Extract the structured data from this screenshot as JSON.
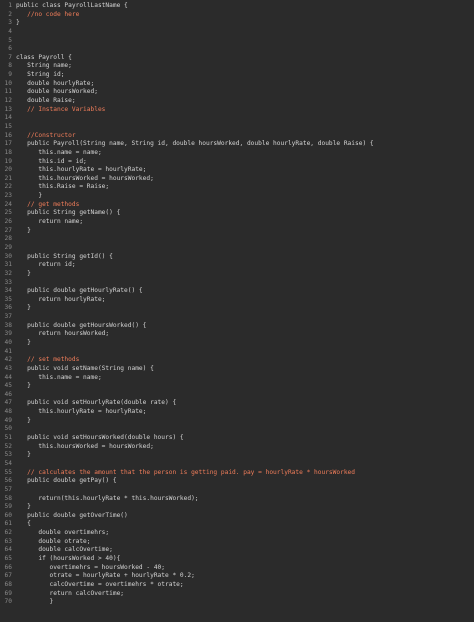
{
  "editor": {
    "colors": {
      "background": "#2b2b2b",
      "text": "#d4d4d4",
      "line_number": "#8a8a8a",
      "comment": "#f07d5a"
    },
    "lines": [
      {
        "n": "1",
        "text": "public class PayrollLastName {"
      },
      {
        "n": "2",
        "text": "   //no code here"
      },
      {
        "n": "3",
        "text": "}"
      },
      {
        "n": "4",
        "text": ""
      },
      {
        "n": "5",
        "text": ""
      },
      {
        "n": "6",
        "text": ""
      },
      {
        "n": "7",
        "text": "class Payroll {"
      },
      {
        "n": "8",
        "text": "   String name;"
      },
      {
        "n": "9",
        "text": "   String id;"
      },
      {
        "n": "10",
        "text": "   double hourlyRate;"
      },
      {
        "n": "11",
        "text": "   double hoursWorked;"
      },
      {
        "n": "12",
        "text": "   double Raise;"
      },
      {
        "n": "13",
        "text": "   // Instance Variables"
      },
      {
        "n": "14",
        "text": ""
      },
      {
        "n": "15",
        "text": ""
      },
      {
        "n": "16",
        "text": "   //Constructor"
      },
      {
        "n": "17",
        "text": "   public Payroll(String name, String id, double hoursWorked, double hourlyRate, double Raise) {"
      },
      {
        "n": "18",
        "text": "      this.name = name;"
      },
      {
        "n": "19",
        "text": "      this.id = id;"
      },
      {
        "n": "20",
        "text": "      this.hourlyRate = hourlyRate;"
      },
      {
        "n": "21",
        "text": "      this.hoursWorked = hoursWorked;"
      },
      {
        "n": "22",
        "text": "      this.Raise = Raise;"
      },
      {
        "n": "23",
        "text": "      }"
      },
      {
        "n": "24",
        "text": "   // get methods"
      },
      {
        "n": "25",
        "text": "   public String getName() {"
      },
      {
        "n": "26",
        "text": "      return name;"
      },
      {
        "n": "27",
        "text": "   }"
      },
      {
        "n": "28",
        "text": ""
      },
      {
        "n": "29",
        "text": ""
      },
      {
        "n": "30",
        "text": "   public String getId() {"
      },
      {
        "n": "31",
        "text": "      return id;"
      },
      {
        "n": "32",
        "text": "   }"
      },
      {
        "n": "33",
        "text": ""
      },
      {
        "n": "34",
        "text": "   public double getHourlyRate() {"
      },
      {
        "n": "35",
        "text": "      return hourlyRate;"
      },
      {
        "n": "36",
        "text": "   }"
      },
      {
        "n": "37",
        "text": ""
      },
      {
        "n": "38",
        "text": "   public double getHoursWorked() {"
      },
      {
        "n": "39",
        "text": "      return hoursWorked;"
      },
      {
        "n": "40",
        "text": "   }"
      },
      {
        "n": "41",
        "text": ""
      },
      {
        "n": "42",
        "text": "   // set methods"
      },
      {
        "n": "43",
        "text": "   public void setName(String name) {"
      },
      {
        "n": "44",
        "text": "      this.name = name;"
      },
      {
        "n": "45",
        "text": "   }"
      },
      {
        "n": "46",
        "text": ""
      },
      {
        "n": "47",
        "text": "   public void setHourlyRate(double rate) {"
      },
      {
        "n": "48",
        "text": "      this.hourlyRate = hourlyRate;"
      },
      {
        "n": "49",
        "text": "   }"
      },
      {
        "n": "50",
        "text": ""
      },
      {
        "n": "51",
        "text": "   public void setHoursWorked(double hours) {"
      },
      {
        "n": "52",
        "text": "      this.hoursWorked = hoursWorked;"
      },
      {
        "n": "53",
        "text": "   }"
      },
      {
        "n": "54",
        "text": ""
      },
      {
        "n": "55",
        "text": "   // calculates the amount that the person is getting paid. pay = hourlyRate * hoursWorked"
      },
      {
        "n": "56",
        "text": "   public double getPay() {"
      },
      {
        "n": "57",
        "text": ""
      },
      {
        "n": "58",
        "text": "      return(this.hourlyRate * this.hoursWorked);"
      },
      {
        "n": "59",
        "text": "   }"
      },
      {
        "n": "60",
        "text": "   public double getOverTime()"
      },
      {
        "n": "61",
        "text": "   {"
      },
      {
        "n": "62",
        "text": "      double overtimehrs;"
      },
      {
        "n": "63",
        "text": "      double otrate;"
      },
      {
        "n": "64",
        "text": "      double calcOvertime;"
      },
      {
        "n": "65",
        "text": "      if (hoursWorked > 40){"
      },
      {
        "n": "66",
        "text": "         overtimehrs = hoursWorked - 40;"
      },
      {
        "n": "67",
        "text": "         otrate = hourlyRate + hourlyRate * 0.2;"
      },
      {
        "n": "68",
        "text": "         calcOvertime = overtimehrs * otrate;"
      },
      {
        "n": "69",
        "text": "         return calcOvertime;"
      },
      {
        "n": "70",
        "text": "         }"
      }
    ]
  }
}
